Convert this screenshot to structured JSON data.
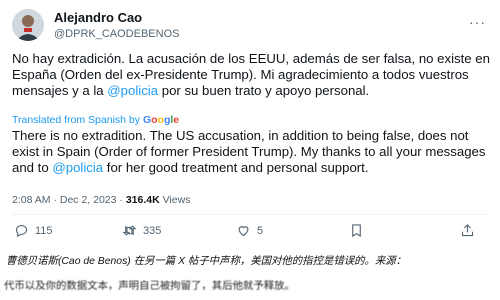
{
  "tweet": {
    "name": "Alejandro Cao",
    "handle": "@DPRK_CAODEBENOS",
    "more_icon": "more-icon",
    "text_original": [
      {
        "t": "No hay extradición. La acusación de los EEUU, además de ser falsa, no existe en España (Orden del ex-Presidente Trump). Mi agradecimiento a todos vuestros mensajes y a la "
      },
      {
        "t": "@policia",
        "mention": true
      },
      {
        "t": " por su buen trato y apoyo personal."
      }
    ],
    "translated_label": "Translated from Spanish by",
    "translated_brand": "Google",
    "text_translated": [
      {
        "t": "There is no extradition. The US accusation, in addition to being false, does not exist in Spain (Order of former President Trump). My thanks to all your messages and to "
      },
      {
        "t": "@policia",
        "mention": true
      },
      {
        "t": " for her good treatment and personal support."
      }
    ],
    "time": "2:08 AM · Dec 2, 2023 · ",
    "views_count": "316.4K",
    "views_label": " Views"
  },
  "actions": {
    "replies": "115",
    "retweets": "335",
    "likes": "5"
  },
  "footer": {
    "line1": "曹德贝诺斯(Cao de Benos) 在另一篇 X 帖子中声称，美国对他的指控是错误的。来源：",
    "line2": "代币以及你的数据文本，声明自己被拘留了，其后他就予释放。"
  },
  "colors": {
    "accent": "#1d9bf0",
    "text": "#0f1419",
    "muted": "#536471"
  }
}
